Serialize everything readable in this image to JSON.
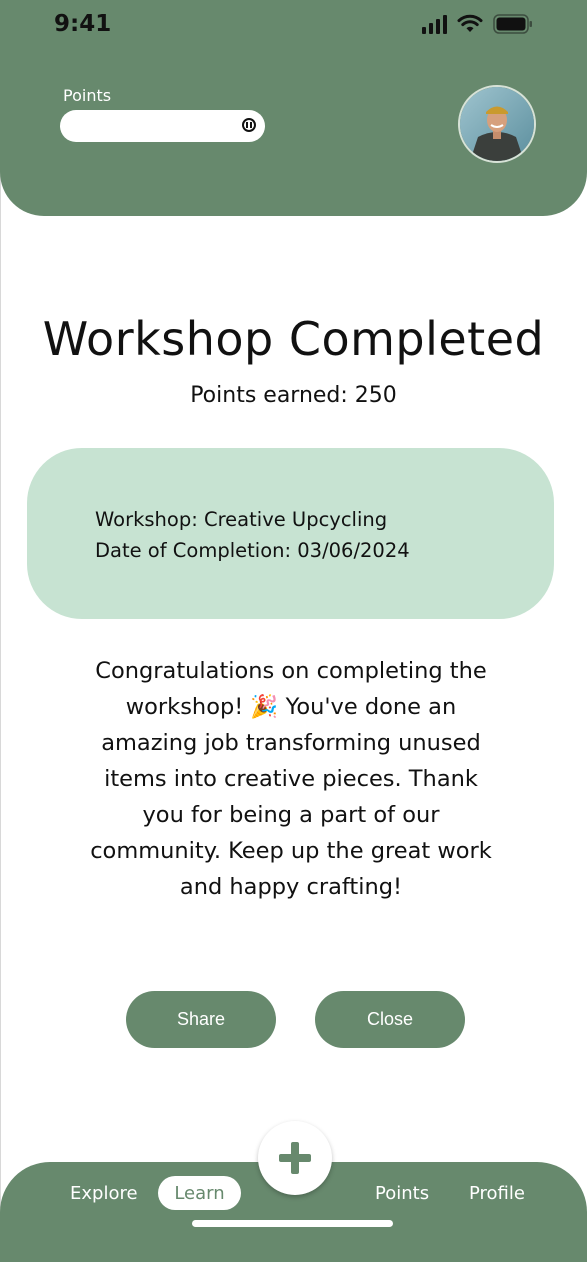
{
  "status_bar": {
    "time": "9:41"
  },
  "header": {
    "points_label": "Points"
  },
  "main": {
    "title": "Workshop Completed",
    "points_earned": "Points earned: 250",
    "details": {
      "workshop": "Workshop: Creative Upcycling",
      "date": "Date of Completion: 03/06/2024"
    },
    "message": "Congratulations on completing the workshop! 🎉 You've done an amazing job transforming unused items into creative pieces. Thank you for being a part of our community. Keep up the great work and happy crafting!",
    "buttons": {
      "share": "Share",
      "close": "Close"
    }
  },
  "nav": {
    "items": [
      {
        "label": "Explore"
      },
      {
        "label": "Learn"
      },
      {
        "label": "Points"
      },
      {
        "label": "Profile"
      }
    ],
    "active": "Learn"
  },
  "colors": {
    "primary": "#67896d",
    "card": "#c7e3d2",
    "text": "#111111",
    "white": "#ffffff"
  },
  "icons": [
    "signal-icon",
    "wifi-icon",
    "battery-icon",
    "info-icon",
    "avatar-image",
    "plus-icon"
  ]
}
